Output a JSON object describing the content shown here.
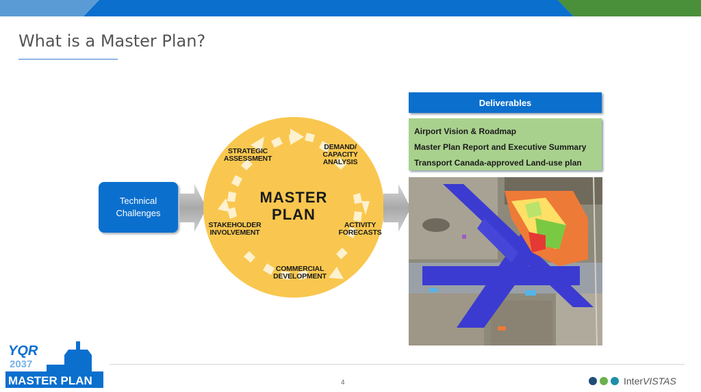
{
  "slide": {
    "title": "What is a Master Plan?",
    "page_number": "4"
  },
  "technical_box": {
    "line1": "Technical",
    "line2": "Challenges"
  },
  "cycle": {
    "center_line1": "MASTER",
    "center_line2": "PLAN",
    "steps": [
      {
        "line1": "STRATEGIC",
        "line2": "ASSESSMENT",
        "line3": ""
      },
      {
        "line1": "DEMAND/",
        "line2": "CAPACITY",
        "line3": "ANALYSIS"
      },
      {
        "line1": "ACTIVITY",
        "line2": "FORECASTS",
        "line3": ""
      },
      {
        "line1": "COMMERCIAL",
        "line2": "DEVELOPMENT",
        "line3": ""
      },
      {
        "line1": "STAKEHOLDER",
        "line2": "INVOLVEMENT",
        "line3": ""
      }
    ]
  },
  "deliverables": {
    "heading": "Deliverables",
    "items": [
      "Airport Vision & Roadmap",
      "Master Plan Report and Executive Summary",
      "Transport Canada-approved Land-use plan"
    ]
  },
  "logo": {
    "code": "YQR",
    "year": "2037",
    "text": "MASTER PLAN"
  },
  "brand": {
    "name_part1": "Inter",
    "name_part2": "VISTAS"
  },
  "colors": {
    "primary_blue": "#0b6fce",
    "deliverables_green": "#a9d18e",
    "cycle_yellow": "#f9c74f",
    "logo_blue": "#0b6fce",
    "dot_navy": "#1f4e79",
    "dot_green": "#6ab04c",
    "dot_teal": "#1e8fa8"
  }
}
